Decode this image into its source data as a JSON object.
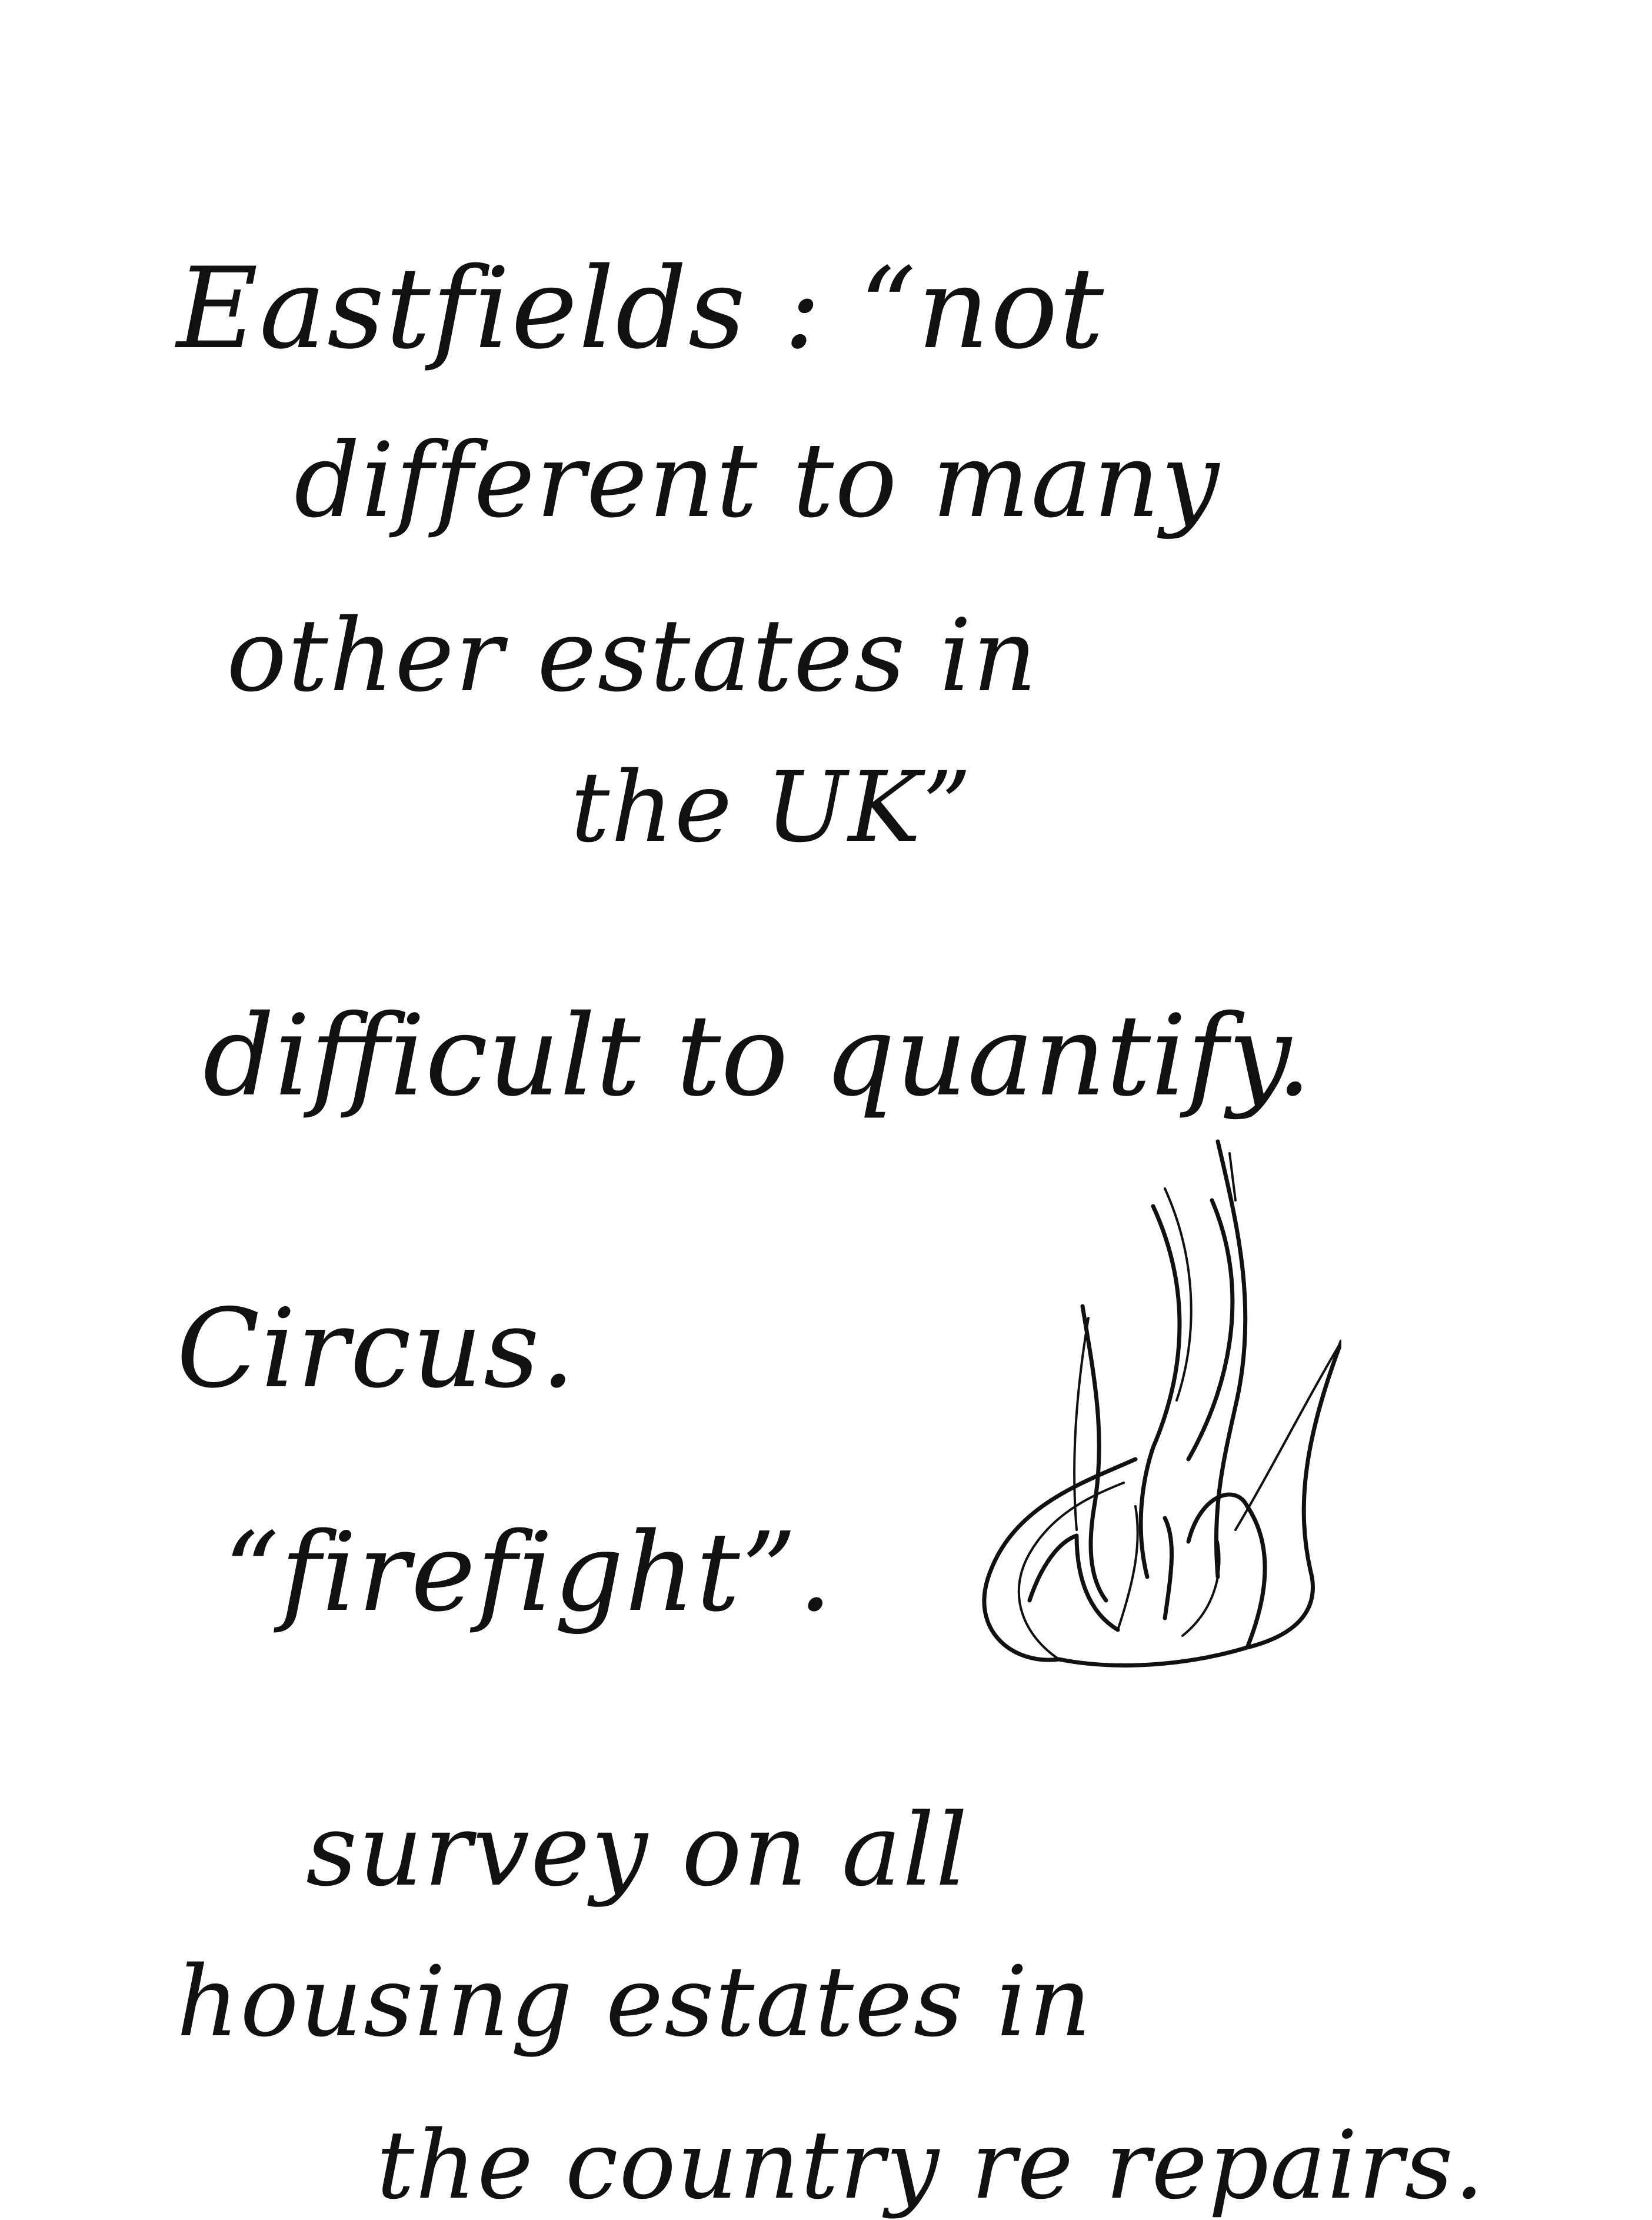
{
  "notes": {
    "lines": [
      "Eastfields : “not",
      "different to many",
      "other estates in",
      "the UK”",
      "difficult to quantify.",
      "Circus.",
      "“firefight”.",
      "survey on all",
      "housing estates in",
      "the country re repairs."
    ]
  },
  "drawing": {
    "icon": "flame-sketch-icon",
    "stroke_color": "#111111"
  }
}
